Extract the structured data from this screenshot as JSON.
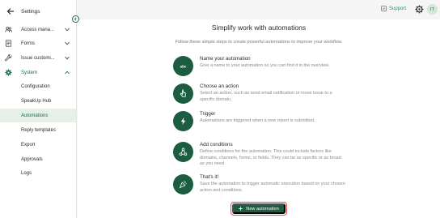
{
  "sidebar": {
    "back_label": "Settings",
    "items": [
      {
        "label": "Access mana...",
        "icon": "people-icon"
      },
      {
        "label": "Forms",
        "icon": "form-icon"
      },
      {
        "label": "Issue customi...",
        "icon": "wrench-icon"
      },
      {
        "label": "System",
        "icon": "gear-icon"
      },
      {
        "label": "Configuration"
      },
      {
        "label": "SpeakUp Hub"
      },
      {
        "label": "Automations"
      },
      {
        "label": "Reply templates"
      },
      {
        "label": "Export"
      },
      {
        "label": "Approvals"
      },
      {
        "label": "Logs"
      }
    ]
  },
  "topbar": {
    "support_label": "Support",
    "avatar_initials": "IT"
  },
  "main": {
    "title": "Simplify work with automations",
    "subtitle": "Follow these simple steps to create powerful automations to improve your workflow.",
    "steps": [
      {
        "title": "Name your automation",
        "desc": "Give a name to your automation so you can find it in the overview.",
        "icon": "text-abc-icon"
      },
      {
        "title": "Choose an action",
        "desc": "Select an action, such as send email notification or move issue to a specific domain.",
        "icon": "pointer-hand-icon"
      },
      {
        "title": "Trigger",
        "desc": "Automations are triggered when a new report is submitted.",
        "icon": "lightning-icon"
      },
      {
        "title": "Add conditions",
        "desc": "Define conditions for the automation. This could include factors like domains, channels, forms, or fields. They can be as specific or as broad as you need.",
        "icon": "conditions-icon"
      },
      {
        "title": "That's it!",
        "desc": "Save the automation to trigger automatic execution based on your chosen action and conditions.",
        "icon": "celebration-icon"
      }
    ],
    "new_button_label": "New automation"
  },
  "colors": {
    "brand_green": "#1c5c40",
    "accent_green": "#1a9c6a",
    "highlight_red": "#e2533f",
    "selected_bg": "#e7efe9"
  }
}
